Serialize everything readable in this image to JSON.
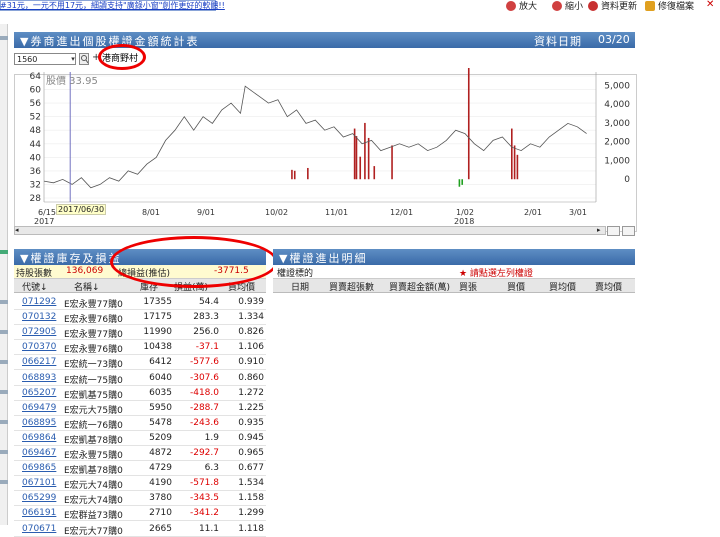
{
  "topbar": {
    "marquee": "#31元，一元不用17元，細讀支持\"廣錄小窗\"創作更好的軟體!!",
    "tools": [
      {
        "label": "放大",
        "icon": "zoom-in-icon",
        "color": "#d04040"
      },
      {
        "label": "縮小",
        "icon": "zoom-out-icon",
        "color": "#d04040"
      },
      {
        "label": "資料更新",
        "icon": "refresh-icon",
        "color": "#c83030"
      },
      {
        "label": "修復檔案",
        "icon": "repair-icon",
        "color": "#e0a020"
      }
    ],
    "close_glyph": "✕"
  },
  "main": {
    "title": "▼券商進出個股權證金額統計表",
    "date_label": "資料日期",
    "date_value": "03/20"
  },
  "controls": {
    "code_value": "1560",
    "dropdown_glyph": "▾",
    "plus_glyph": "+",
    "broker_label": "港商野村"
  },
  "chart_data": {
    "type": "line",
    "price_label": "股價 33.95",
    "cursor_label": "2017/06/30",
    "x_ticks": [
      "6/15",
      "8/01",
      "9/01",
      "10/02",
      "11/01",
      "12/01",
      "1/02",
      "2/01",
      "3/01"
    ],
    "x_years": [
      "2017",
      "2018"
    ],
    "left_axis": {
      "min": 28,
      "max": 64,
      "ticks": [
        28,
        32,
        36,
        40,
        44,
        48,
        52,
        56,
        60,
        64
      ]
    },
    "right_axis": {
      "min": -1000,
      "max": 5500,
      "ticks": [
        0,
        1000,
        2000,
        3000,
        4000,
        5000
      ],
      "tick_labels": [
        "0",
        "1,000",
        "2,000",
        "3,000",
        "4,000",
        "5,000"
      ]
    },
    "price_series": [
      [
        0,
        33
      ],
      [
        10,
        32.5
      ],
      [
        20,
        33.5
      ],
      [
        30,
        32
      ],
      [
        40,
        34
      ],
      [
        50,
        31
      ],
      [
        60,
        32
      ],
      [
        70,
        34
      ],
      [
        80,
        33
      ],
      [
        90,
        36
      ],
      [
        100,
        35
      ],
      [
        110,
        38
      ],
      [
        120,
        40
      ],
      [
        130,
        45
      ],
      [
        140,
        48
      ],
      [
        150,
        52
      ],
      [
        160,
        48
      ],
      [
        170,
        52
      ],
      [
        180,
        50
      ],
      [
        190,
        54
      ],
      [
        200,
        56
      ],
      [
        210,
        53
      ],
      [
        215,
        61
      ],
      [
        220,
        60
      ],
      [
        230,
        58
      ],
      [
        240,
        56
      ],
      [
        250,
        57
      ],
      [
        260,
        52
      ],
      [
        270,
        54
      ],
      [
        280,
        50
      ],
      [
        290,
        51
      ],
      [
        300,
        48
      ],
      [
        310,
        49
      ],
      [
        320,
        46
      ],
      [
        330,
        47
      ],
      [
        340,
        44
      ],
      [
        350,
        45
      ],
      [
        360,
        42
      ],
      [
        370,
        43
      ],
      [
        380,
        44
      ],
      [
        390,
        43
      ],
      [
        400,
        44
      ],
      [
        410,
        42
      ],
      [
        420,
        43
      ],
      [
        430,
        45
      ],
      [
        440,
        48
      ],
      [
        450,
        47
      ],
      [
        460,
        44
      ],
      [
        470,
        42
      ],
      [
        480,
        45
      ],
      [
        490,
        46
      ],
      [
        500,
        43
      ],
      [
        510,
        42
      ],
      [
        520,
        44
      ],
      [
        530,
        43
      ],
      [
        540,
        46
      ],
      [
        550,
        48
      ],
      [
        560,
        50
      ],
      [
        570,
        49
      ],
      [
        580,
        47
      ]
    ],
    "bar_series": [
      {
        "x": 265,
        "v": 500,
        "color": "#b02020"
      },
      {
        "x": 268,
        "v": 450,
        "color": "#b02020"
      },
      {
        "x": 282,
        "v": 600,
        "color": "#b02020"
      },
      {
        "x": 332,
        "v": 2700,
        "color": "#b02020"
      },
      {
        "x": 334,
        "v": 2300,
        "color": "#b02020"
      },
      {
        "x": 338,
        "v": 1200,
        "color": "#b02020"
      },
      {
        "x": 343,
        "v": 3000,
        "color": "#b02020"
      },
      {
        "x": 347,
        "v": 2200,
        "color": "#b02020"
      },
      {
        "x": 353,
        "v": 700,
        "color": "#b02020"
      },
      {
        "x": 372,
        "v": 1800,
        "color": "#b02020"
      },
      {
        "x": 444,
        "v": -400,
        "color": "#20a020"
      },
      {
        "x": 447,
        "v": -300,
        "color": "#20a020"
      },
      {
        "x": 454,
        "v": 6300,
        "color": "#b02020"
      },
      {
        "x": 500,
        "v": 2700,
        "color": "#b02020"
      },
      {
        "x": 503,
        "v": 1800,
        "color": "#b02020"
      },
      {
        "x": 506,
        "v": 1300,
        "color": "#b02020"
      }
    ]
  },
  "inventory": {
    "title": "▼權證庫存及損益",
    "summary_label": "持股張數",
    "summary_value": "136,069",
    "pl_label": "總損益(推估)",
    "pl_value": "-3771.5",
    "headers": [
      "代號↓",
      "名稱↓",
      "庫存",
      "損益(萬)",
      "買均價"
    ],
    "rows": [
      {
        "code": "071292",
        "name": "E宏永豐77購0",
        "stock": "17355",
        "pl": "54.4",
        "price": "0.939"
      },
      {
        "code": "070132",
        "name": "E宏永豐76購0",
        "stock": "17175",
        "pl": "283.3",
        "price": "1.334"
      },
      {
        "code": "072905",
        "name": "E宏永豐77購0",
        "stock": "11990",
        "pl": "256.0",
        "price": "0.826"
      },
      {
        "code": "070370",
        "name": "E宏永豐76購0",
        "stock": "10438",
        "pl": "-37.1",
        "price": "1.106"
      },
      {
        "code": "066217",
        "name": "E宏統一73購0",
        "stock": "6412",
        "pl": "-577.6",
        "price": "0.910"
      },
      {
        "code": "068893",
        "name": "E宏統一75購0",
        "stock": "6040",
        "pl": "-307.6",
        "price": "0.860"
      },
      {
        "code": "065207",
        "name": "E宏凱基75購0",
        "stock": "6035",
        "pl": "-418.0",
        "price": "1.272"
      },
      {
        "code": "069479",
        "name": "E宏元大75購0",
        "stock": "5950",
        "pl": "-288.7",
        "price": "1.225"
      },
      {
        "code": "068895",
        "name": "E宏統一76購0",
        "stock": "5478",
        "pl": "-243.6",
        "price": "0.935"
      },
      {
        "code": "069864",
        "name": "E宏凱基78購0",
        "stock": "5209",
        "pl": "1.9",
        "price": "0.945"
      },
      {
        "code": "069467",
        "name": "E宏永豐75購0",
        "stock": "4872",
        "pl": "-292.7",
        "price": "0.965"
      },
      {
        "code": "069865",
        "name": "E宏凱基78購0",
        "stock": "4729",
        "pl": "6.3",
        "price": "0.677"
      },
      {
        "code": "067101",
        "name": "E宏元大74購0",
        "stock": "4190",
        "pl": "-571.8",
        "price": "1.534"
      },
      {
        "code": "065299",
        "name": "E宏元大74購0",
        "stock": "3780",
        "pl": "-343.5",
        "price": "1.158"
      },
      {
        "code": "066191",
        "name": "E宏群益73購0",
        "stock": "2710",
        "pl": "-341.2",
        "price": "1.299"
      },
      {
        "code": "070671",
        "name": "E宏元大77購0",
        "stock": "2665",
        "pl": "11.1",
        "price": "1.118"
      }
    ]
  },
  "outflow": {
    "title": "▼權證進出明細",
    "label": "權證標的",
    "hint": "★ 請點選左列權證",
    "headers": [
      "日期",
      "買賣超張數",
      "買賣超金額(萬)",
      "買張",
      "買價",
      "買均價",
      "賣均價"
    ]
  }
}
